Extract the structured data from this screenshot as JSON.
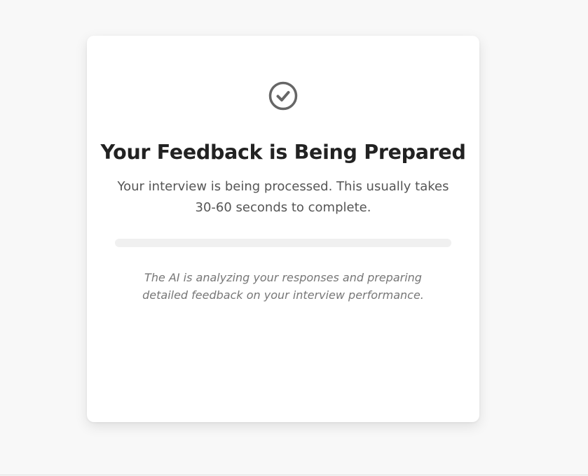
{
  "page": {
    "background_color": "#f8f8f8"
  },
  "card": {
    "status_icon": "check-circle-icon",
    "title": "Your Feedback is Being Prepared",
    "subtitle": "Your interview is being processed. This usually takes 30-60 seconds to complete.",
    "progress": {
      "value_fraction": 0,
      "track_color": "#f0f0f0"
    },
    "note": "The AI is analyzing your responses and preparing detailed feedback on your interview performance."
  },
  "colors": {
    "title": "#222222",
    "body_text": "#555555",
    "note_text": "#777777",
    "icon": "#666666"
  }
}
